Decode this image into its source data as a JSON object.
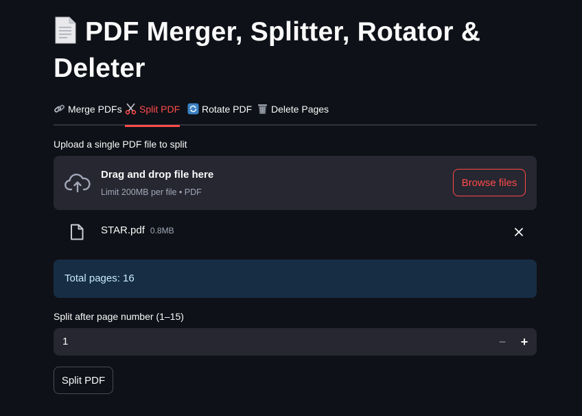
{
  "header": {
    "title": "PDF Merger, Splitter, Rotator & Deleter",
    "title_icon": "page-facing-up-icon"
  },
  "tabs": [
    {
      "label": "Merge PDFs",
      "icon": "link-icon",
      "active": false
    },
    {
      "label": "Split PDF",
      "icon": "scissors-icon",
      "active": true
    },
    {
      "label": "Rotate PDF",
      "icon": "counterclockwise-arrows-icon",
      "active": false
    },
    {
      "label": "Delete Pages",
      "icon": "wastebasket-icon",
      "active": false
    }
  ],
  "uploader": {
    "label": "Upload a single PDF file to split",
    "drag_text": "Drag and drop file here",
    "limit_text": "Limit 200MB per file • PDF",
    "browse_label": "Browse files"
  },
  "file": {
    "name": "STAR.pdf",
    "size": "0.8MB"
  },
  "info": {
    "text": "Total pages: 16"
  },
  "split_input": {
    "label": "Split after page number (1–15)",
    "value": "1",
    "minus": "−",
    "plus": "+"
  },
  "actions": {
    "split_label": "Split PDF"
  },
  "colors": {
    "background": "#0e1117",
    "accent": "#ff4b4b",
    "widget_bg": "#262730",
    "info_bg": "#172d43",
    "info_text": "#c7ebff"
  }
}
